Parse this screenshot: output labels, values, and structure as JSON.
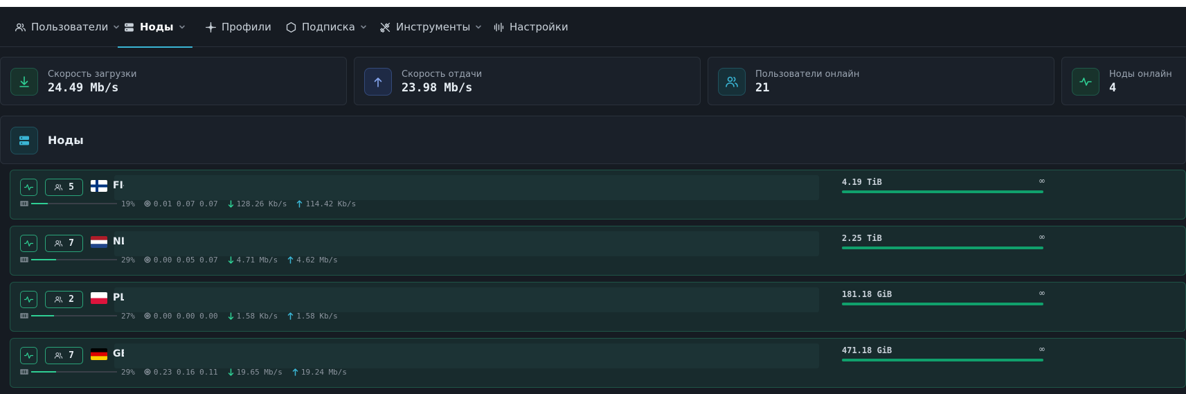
{
  "nav": {
    "items": [
      {
        "label": "Пользователи",
        "icon": "users-icon",
        "dropdown": true,
        "active": false
      },
      {
        "label": "Ноды",
        "icon": "server-icon",
        "dropdown": true,
        "active": true
      },
      {
        "label": "Профили",
        "icon": "sparkle-icon",
        "dropdown": false,
        "active": false
      },
      {
        "label": "Подписка",
        "icon": "hexagon-icon",
        "dropdown": true,
        "active": false
      },
      {
        "label": "Инструменты",
        "icon": "tools-icon",
        "dropdown": true,
        "active": false
      },
      {
        "label": "Настройки",
        "icon": "sliders-icon",
        "dropdown": false,
        "active": false
      }
    ]
  },
  "stats": [
    {
      "label": "Скорость загрузки",
      "value": "24.49 Mb/s",
      "icon": "download-icon"
    },
    {
      "label": "Скорость отдачи",
      "value": "23.98 Mb/s",
      "icon": "upload-icon"
    },
    {
      "label": "Пользователи онлайн",
      "value": "21",
      "icon": "users-online-icon"
    },
    {
      "label": "Ноды онлайн",
      "value": "4",
      "icon": "pulse-icon"
    }
  ],
  "section": {
    "title": "Ноды"
  },
  "nodes": [
    {
      "users": "5",
      "name": "FI-",
      "flag": "fi",
      "ram_pct_label": "19%",
      "ram_fraction": 0.19,
      "load": "0.01 0.07 0.07",
      "down": "128.26 Kb/s",
      "up": "114.42 Kb/s",
      "traffic": "4.19 TiB",
      "limit": "∞"
    },
    {
      "users": "7",
      "name": "NL",
      "flag": "nl",
      "ram_pct_label": "29%",
      "ram_fraction": 0.29,
      "load": "0.00 0.05 0.07",
      "down": "4.71 Mb/s",
      "up": "4.62 Mb/s",
      "traffic": "2.25 TiB",
      "limit": "∞"
    },
    {
      "users": "2",
      "name": "PL",
      "flag": "pl",
      "ram_pct_label": "27%",
      "ram_fraction": 0.27,
      "load": "0.00 0.00 0.00",
      "down": "1.58 Kb/s",
      "up": "1.58 Kb/s",
      "traffic": "181.18 GiB",
      "limit": "∞"
    },
    {
      "users": "7",
      "name": "GE",
      "flag": "de",
      "ram_pct_label": "29%",
      "ram_fraction": 0.29,
      "load": "0.23 0.16 0.11",
      "down": "19.65 Mb/s",
      "up": "19.24 Mb/s",
      "traffic": "471.18 GiB",
      "limit": "∞"
    }
  ],
  "colors": {
    "accent": "#3ab5d4",
    "online": "#2fcf94",
    "traffic_bar": "#10a06c"
  }
}
